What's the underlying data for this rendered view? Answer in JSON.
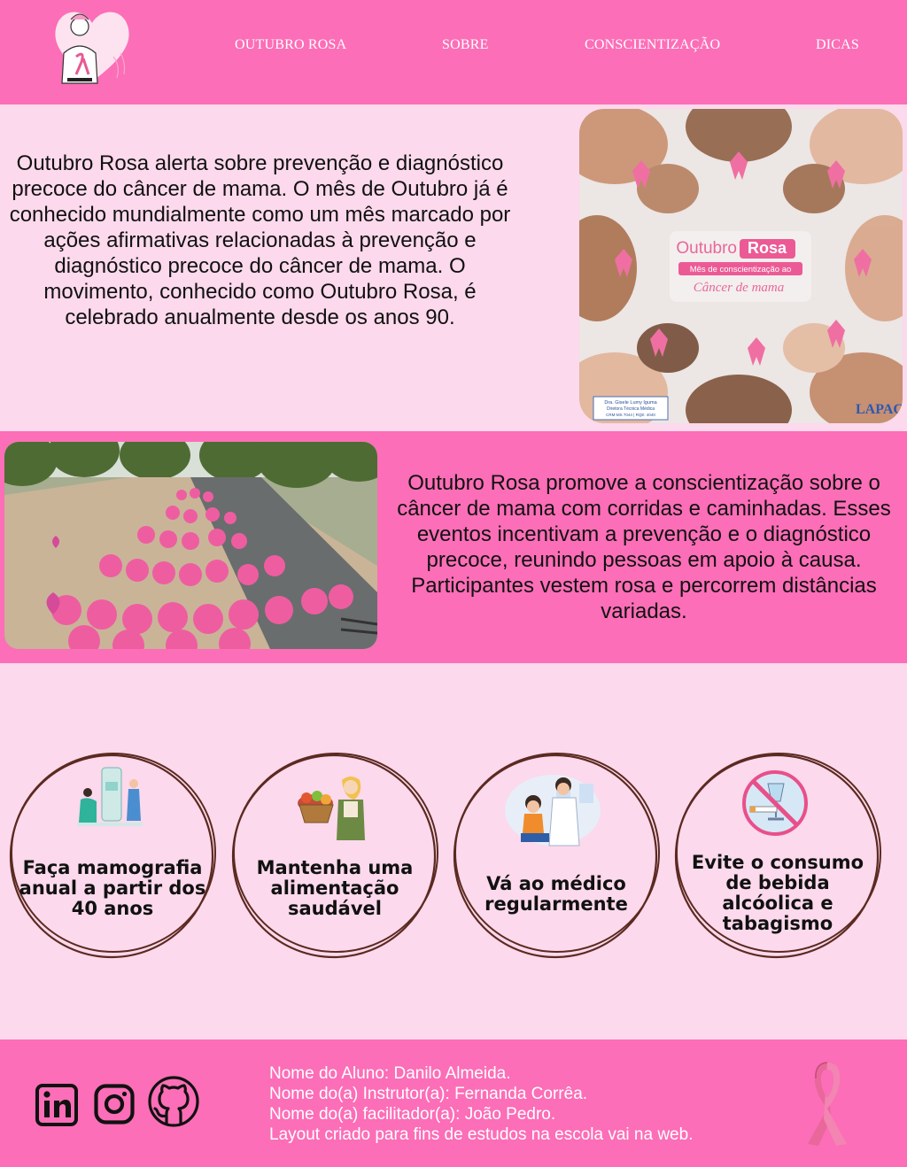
{
  "header": {
    "logo_icon": "woman-pink-ribbon-logo",
    "nav": [
      "OUTUBRO ROSA",
      "SOBRE",
      "CONSCIENTIZAÇÃO",
      "DICAS"
    ]
  },
  "section_about": {
    "text": "Outubro Rosa alerta sobre prevenção e diagnóstico precoce do câncer de mama. O mês de Outubro já é conhecido mundialmente como um mês marcado por ações afirmativas relacionadas à prevenção e diagnóstico precoce do câncer de mama. O movimento, conhecido como Outubro Rosa, é celebrado anualmente desde os anos 90.",
    "image": {
      "title_a": "Outubro",
      "title_b": "Rosa",
      "subtitle": "Mês de conscientização ao",
      "subtitle2": "Câncer de mama",
      "credit_1": "Dra. Gisele Lumy Iguma",
      "credit_2": "Diretora Técnica Médica",
      "credit_3": "CRM-MS 7044 | RQE: 4040",
      "brand": "LAPAC"
    }
  },
  "section_awareness": {
    "text": "Outubro Rosa promove a conscientização sobre o câncer de mama com corridas e caminhadas. Esses eventos incentivam a prevenção e o diagnóstico precoce, reunindo pessoas em apoio à causa. Participantes vestem rosa e percorrem distâncias variadas."
  },
  "tips": [
    {
      "label": "Faça mamografia anual a partir dos 40 anos",
      "icon": "mammography-icon"
    },
    {
      "label": "Mantenha uma alimentação saudável",
      "icon": "healthy-food-icon"
    },
    {
      "label": "Vá ao médico regularmente",
      "icon": "doctor-visit-icon"
    },
    {
      "label": "Evite o consumo de bebida alcóolica e tabagismo",
      "icon": "no-alcohol-no-smoking-icon"
    }
  ],
  "footer": {
    "lines": [
      "Nome do Aluno: Danilo Almeida.",
      "Nome do(a) Instrutor(a): Fernanda Corrêa.",
      "Nome do(a) facilitador(a): João Pedro.",
      "Layout criado para fins de estudos na escola vai na web."
    ],
    "social": [
      "linkedin-icon",
      "instagram-icon",
      "github-icon"
    ]
  },
  "colors": {
    "pink_strong": "#fc6eb7",
    "pink_light": "#fcd9ec",
    "ring_brown": "#5b2a20"
  }
}
